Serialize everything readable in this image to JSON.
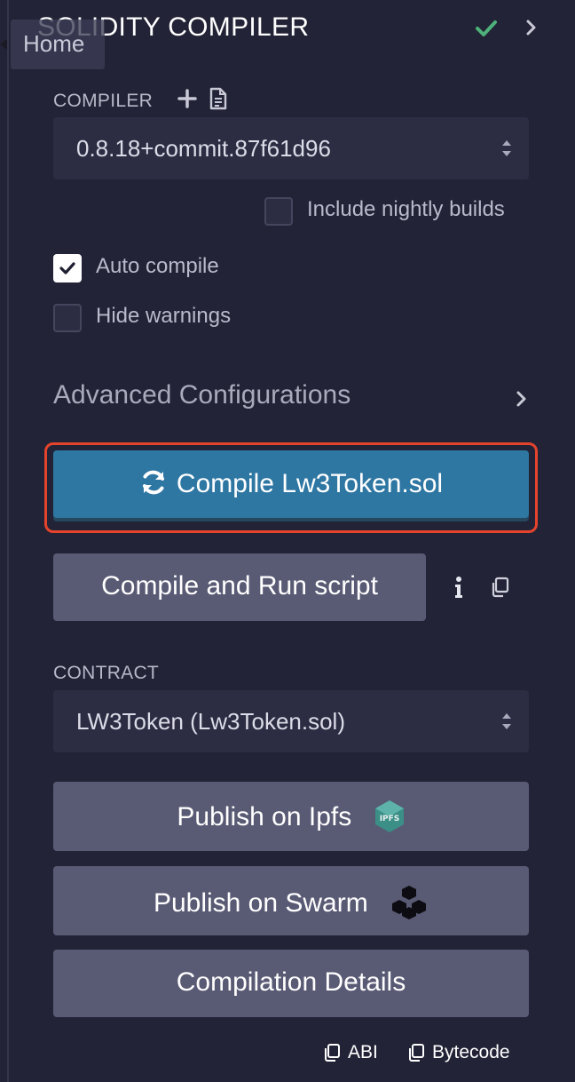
{
  "header": {
    "title": "SOLIDITY COMPILER"
  },
  "tooltip": {
    "text": "Home"
  },
  "compiler": {
    "label": "COMPILER",
    "version": "0.8.18+commit.87f61d96",
    "nightly_label": "Include nightly builds",
    "nightly_checked": false
  },
  "options": {
    "auto_compile_label": "Auto compile",
    "auto_compile_checked": true,
    "hide_warnings_label": "Hide warnings",
    "hide_warnings_checked": false
  },
  "advanced": {
    "label": "Advanced Configurations"
  },
  "actions": {
    "compile_label": "Compile Lw3Token.sol",
    "run_script_label": "Compile and Run script"
  },
  "contract": {
    "label": "CONTRACT",
    "selected": "LW3Token (Lw3Token.sol)"
  },
  "publish": {
    "ipfs_label": "Publish on Ipfs",
    "ipfs_badge": "IPFS",
    "swarm_label": "Publish on Swarm",
    "details_label": "Compilation Details"
  },
  "footer": {
    "abi_label": "ABI",
    "bytecode_label": "Bytecode"
  },
  "colors": {
    "background": "#222336",
    "primary_button": "#2f77a3",
    "secondary_button": "#595a74",
    "highlight": "#e4432c",
    "success": "#4eb07a"
  }
}
